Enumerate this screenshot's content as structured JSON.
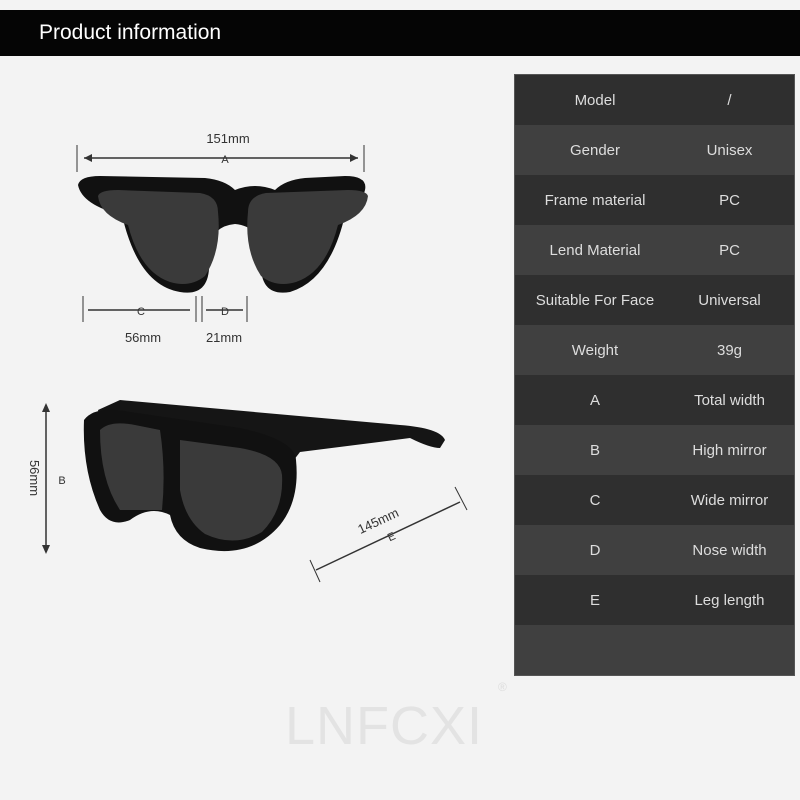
{
  "header": {
    "title": "Product information"
  },
  "specs": [
    {
      "key": "Model",
      "value": "/"
    },
    {
      "key": "Gender",
      "value": "Unisex"
    },
    {
      "key": "Frame material",
      "value": "PC"
    },
    {
      "key": "Lend Material",
      "value": "PC"
    },
    {
      "key": "Suitable For Face",
      "value": "Universal"
    },
    {
      "key": "Weight",
      "value": "39g"
    },
    {
      "key": "A",
      "value": "Total width"
    },
    {
      "key": "B",
      "value": "High mirror"
    },
    {
      "key": "C",
      "value": "Wide mirror"
    },
    {
      "key": "D",
      "value": "Nose width"
    },
    {
      "key": "E",
      "value": "Leg length"
    },
    {
      "key": "",
      "value": ""
    }
  ],
  "dimensions": {
    "a_value": "151mm",
    "a_label": "A",
    "c_value": "56mm",
    "c_label": "C",
    "d_value": "21mm",
    "d_label": "D",
    "b_value": "56mm",
    "b_label": "B",
    "e_value": "145mm",
    "e_label": "E"
  },
  "brand": {
    "watermark": "LNFCXI",
    "registered": "®"
  }
}
